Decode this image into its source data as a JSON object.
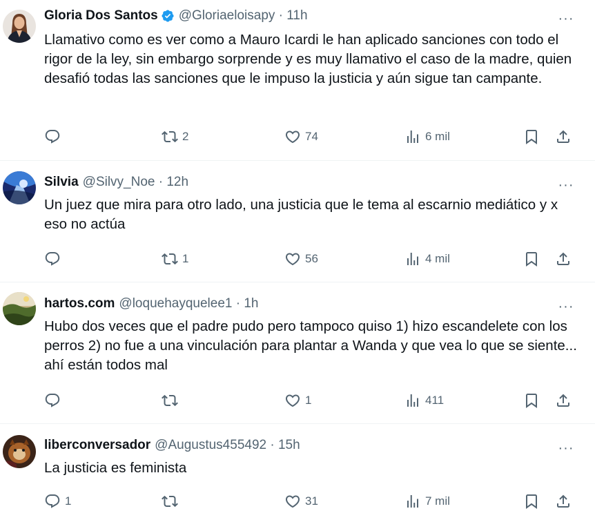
{
  "tweets": [
    {
      "name": "Gloria Dos Santos",
      "verified": true,
      "handle_time": "@Gloriaeloisapy · 11h",
      "text": "Llamativo como es ver como a Mauro Icardi le han aplicado sanciones con todo el rigor de la ley, sin embargo sorprende y es muy llamativo el caso de la madre, quien desafió todas las sanciones que le impuso la justicia y aún sigue tan campante.",
      "replies": "",
      "retweets": "2",
      "likes": "74",
      "views": "6 mil"
    },
    {
      "name": "Silvia",
      "verified": false,
      "handle_time": "@Silvy_Noe · 12h",
      "text": "Un juez que mira para otro lado, una justicia que le tema al escarnio mediático y x eso no actúa",
      "replies": "",
      "retweets": "1",
      "likes": "56",
      "views": "4 mil"
    },
    {
      "name": "hartos.com",
      "verified": false,
      "handle_time": "@loquehayquelee1 · 1h",
      "text": "Hubo dos veces que el padre pudo pero tampoco quiso 1) hizo escandelete con los perros 2) no fue a una vinculación para plantar a Wanda y que vea lo que se siente... ahí están todos mal",
      "replies": "",
      "retweets": "",
      "likes": "1",
      "views": "411"
    },
    {
      "name": "liberconversador",
      "verified": false,
      "handle_time": "@Augustus455492 · 15h",
      "text": "La justicia es feminista",
      "replies": "1",
      "retweets": "",
      "likes": "31",
      "views": "7 mil"
    }
  ],
  "icons": {
    "reply": "reply-icon",
    "retweet": "retweet-icon",
    "like": "heart-icon",
    "views": "views-icon",
    "bookmark": "bookmark-icon",
    "share": "share-icon",
    "more": "more-icon",
    "verified": "verified-badge-icon"
  },
  "colors": {
    "text": "#0f1419",
    "secondary": "#536471",
    "verified": "#1d9bf0",
    "divider": "#eff3f4"
  }
}
